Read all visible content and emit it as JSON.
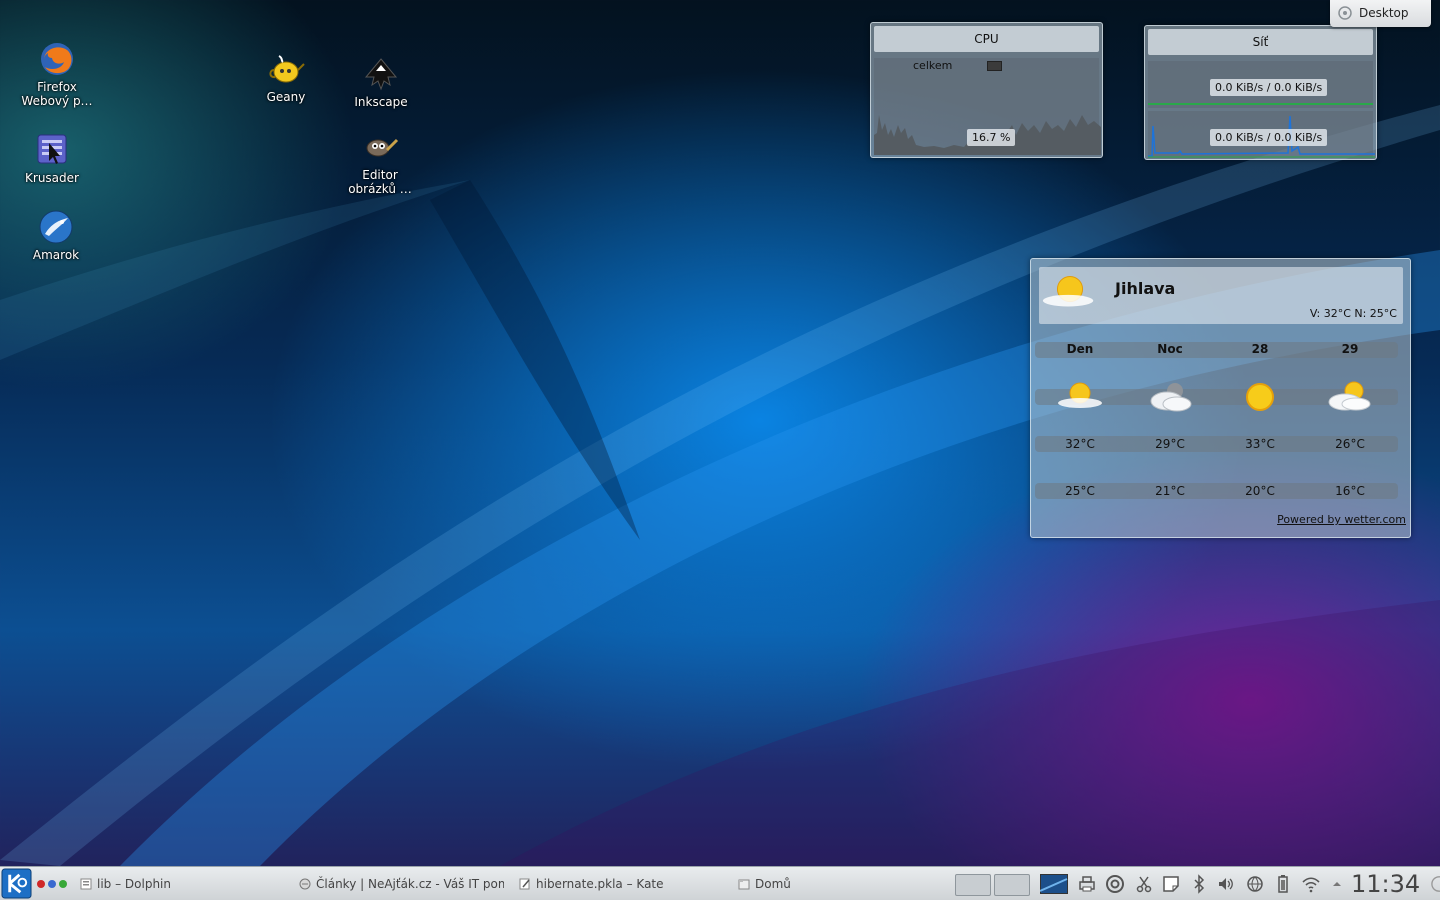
{
  "desktop_icons": [
    {
      "label_line1": "Firefox",
      "label_line2": "Webový p…",
      "icon": "firefox-icon"
    },
    {
      "label_line1": "Krusader",
      "label_line2": "",
      "icon": "krusader-icon"
    },
    {
      "label_line1": "Amarok",
      "label_line2": "",
      "icon": "amarok-icon"
    },
    {
      "label_line1": "Geany",
      "label_line2": "",
      "icon": "geany-icon"
    },
    {
      "label_line1": "Inkscape",
      "label_line2": "",
      "icon": "inkscape-icon"
    },
    {
      "label_line1": "Editor",
      "label_line2": "obrázků …",
      "icon": "gimp-icon"
    }
  ],
  "cpu_widget": {
    "title": "CPU",
    "legend_label": "celkem",
    "value": "16.7 %",
    "series_color": "#3b3b3b"
  },
  "network_widget": {
    "title": "Síť",
    "row1_value": "0.0 KiB/s / 0.0 KiB/s",
    "row2_value": "0.0 KiB/s / 0.0 KiB/s",
    "line_colors": [
      "#2aa84a",
      "#1e73d8"
    ]
  },
  "weather": {
    "city": "Jihlava",
    "hi_lo": "V: 32°C N: 25°C",
    "days": [
      {
        "label": "Den",
        "high": "32°C",
        "low": "25°C",
        "icon": "partly-cloudy-sun-icon"
      },
      {
        "label": "Noc",
        "high": "29°C",
        "low": "21°C",
        "icon": "cloudy-moon-icon"
      },
      {
        "label": "28",
        "high": "33°C",
        "low": "20°C",
        "icon": "sun-icon"
      },
      {
        "label": "29",
        "high": "26°C",
        "low": "16°C",
        "icon": "partly-cloudy-sun-icon"
      }
    ],
    "powered_by": "Powered by wetter.com"
  },
  "desktop_button": {
    "label": "Desktop"
  },
  "taskbar": {
    "tasks": [
      {
        "label": "lib – Dolphin",
        "icon": "dolphin-icon"
      },
      {
        "label": "Články | NeAjťák.cz - Váš IT pomoc",
        "icon": "browser-icon"
      },
      {
        "label": "hibernate.pkla – Kate",
        "icon": "kate-icon"
      },
      {
        "label": "Domů",
        "icon": "folder-icon"
      }
    ],
    "clock": "11:34"
  }
}
